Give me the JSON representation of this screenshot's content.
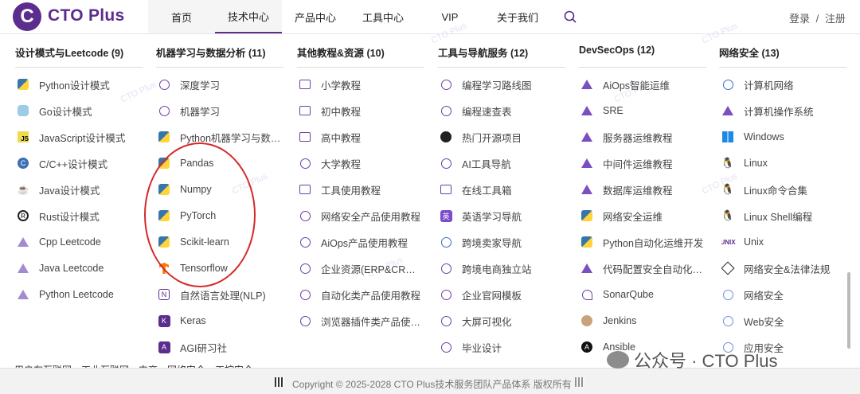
{
  "header": {
    "logo_text": "C",
    "brand": "CTO Plus",
    "nav": [
      "首页",
      "技术中心",
      "产品中心",
      "工具中心",
      "VIP",
      "关于我们"
    ],
    "auth": {
      "login": "登录",
      "sep": "/",
      "register": "注册"
    }
  },
  "watermark_tag": "CTO Plus",
  "columns": [
    {
      "title": "设计模式与Leetcode (9)",
      "items": [
        {
          "label": "Python设计模式",
          "icon": "python-icon"
        },
        {
          "label": "Go设计模式",
          "icon": "go-icon"
        },
        {
          "label": "JavaScript设计模式",
          "icon": "javascript-icon"
        },
        {
          "label": "C/C++设计模式",
          "icon": "cpp-icon"
        },
        {
          "label": "Java设计模式",
          "icon": "java-icon"
        },
        {
          "label": "Rust设计模式",
          "icon": "rust-icon"
        },
        {
          "label": "Cpp Leetcode",
          "icon": "leetcode-icon"
        },
        {
          "label": "Java Leetcode",
          "icon": "leetcode-icon"
        },
        {
          "label": "Python Leetcode",
          "icon": "leetcode-icon"
        }
      ]
    },
    {
      "title": "机器学习与数据分析 (11)",
      "items": [
        {
          "label": "深度学习",
          "icon": "openai-icon"
        },
        {
          "label": "机器学习",
          "icon": "openai-icon"
        },
        {
          "label": "Python机器学习与数…",
          "icon": "python-icon"
        },
        {
          "label": "Pandas",
          "icon": "python-icon"
        },
        {
          "label": "Numpy",
          "icon": "python-icon"
        },
        {
          "label": "PyTorch",
          "icon": "python-icon"
        },
        {
          "label": "Scikit-learn",
          "icon": "python-icon"
        },
        {
          "label": "Tensorflow",
          "icon": "tensorflow-icon"
        },
        {
          "label": "自然语言处理(NLP)",
          "icon": "nlp-icon"
        },
        {
          "label": "Keras",
          "icon": "keras-icon"
        },
        {
          "label": "AGI研习社",
          "icon": "agi-icon"
        }
      ]
    },
    {
      "title": "其他教程&资源 (10)",
      "items": [
        {
          "label": "小学教程",
          "icon": "grid-icon"
        },
        {
          "label": "初中教程",
          "icon": "grid-icon"
        },
        {
          "label": "高中教程",
          "icon": "grid-icon"
        },
        {
          "label": "大学教程",
          "icon": "graduation-cap-icon"
        },
        {
          "label": "工具使用教程",
          "icon": "window-icon"
        },
        {
          "label": "网络安全产品使用教程",
          "icon": "shield-icon"
        },
        {
          "label": "AiOps产品使用教程",
          "icon": "ai-icon"
        },
        {
          "label": "企业资源(ERP&CRM)…",
          "icon": "erp-icon"
        },
        {
          "label": "自动化类产品使用教程",
          "icon": "robot-arm-icon"
        },
        {
          "label": "浏览器插件类产品使用…",
          "icon": "plugin-icon"
        }
      ]
    },
    {
      "title": "工具与导航服务 (12)",
      "items": [
        {
          "label": "编程学习路线图",
          "icon": "roadmap-icon"
        },
        {
          "label": "编程速查表",
          "icon": "search-icon"
        },
        {
          "label": "热门开源项目",
          "icon": "github-icon"
        },
        {
          "label": "AI工具导航",
          "icon": "openai-icon"
        },
        {
          "label": "在线工具箱",
          "icon": "window-icon"
        },
        {
          "label": "英语学习导航",
          "icon": "english-icon"
        },
        {
          "label": "跨境卖家导航",
          "icon": "globe-icon"
        },
        {
          "label": "跨境电商独立站",
          "icon": "shop-icon"
        },
        {
          "label": "企业官网模板",
          "icon": "template-icon"
        },
        {
          "label": "大屏可视化",
          "icon": "chart-icon"
        },
        {
          "label": "毕业设计",
          "icon": "graduation-cap-icon"
        }
      ]
    },
    {
      "title": "DevSecOps (12)",
      "items": [
        {
          "label": "AiOps智能运维",
          "icon": "devsecops-icon"
        },
        {
          "label": "SRE",
          "icon": "devsecops-icon"
        },
        {
          "label": "服务器运维教程",
          "icon": "devsecops-icon"
        },
        {
          "label": "中间件运维教程",
          "icon": "devsecops-icon"
        },
        {
          "label": "数据库运维教程",
          "icon": "devsecops-icon"
        },
        {
          "label": "网络安全运维",
          "icon": "python-icon"
        },
        {
          "label": "Python自动化运维开发",
          "icon": "python-icon"
        },
        {
          "label": "代码配置安全自动化巡检",
          "icon": "devsecops-icon"
        },
        {
          "label": "SonarQube",
          "icon": "sonarqube-icon"
        },
        {
          "label": "Jenkins",
          "icon": "jenkins-icon"
        },
        {
          "label": "Ansible",
          "icon": "ansible-icon"
        }
      ]
    },
    {
      "title": "网络安全 (13)",
      "items": [
        {
          "label": "计算机网络",
          "icon": "globe-icon"
        },
        {
          "label": "计算机操作系统",
          "icon": "devsecops-icon"
        },
        {
          "label": "Windows",
          "icon": "windows-icon"
        },
        {
          "label": "Linux",
          "icon": "linux-icon"
        },
        {
          "label": "Linux命令合集",
          "icon": "linux-icon"
        },
        {
          "label": "Linux Shell编程",
          "icon": "linux-icon"
        },
        {
          "label": "Unix",
          "icon": "unix-icon"
        },
        {
          "label": "网络安全&法律法规",
          "icon": "tag-icon"
        },
        {
          "label": "网络安全",
          "icon": "security-icon"
        },
        {
          "label": "Web安全",
          "icon": "security-icon"
        },
        {
          "label": "应用安全",
          "icon": "security-icon"
        }
      ]
    }
  ],
  "bottom_snippet": "用户在互联网、工业互联网、电商、网络安全、工控安全、",
  "footer": {
    "copyright": "Copyright © 2025-2028 CTO Plus技术服务团队产品体系 版权所有"
  },
  "wechat_watermark": "公众号 · CTO Plus"
}
